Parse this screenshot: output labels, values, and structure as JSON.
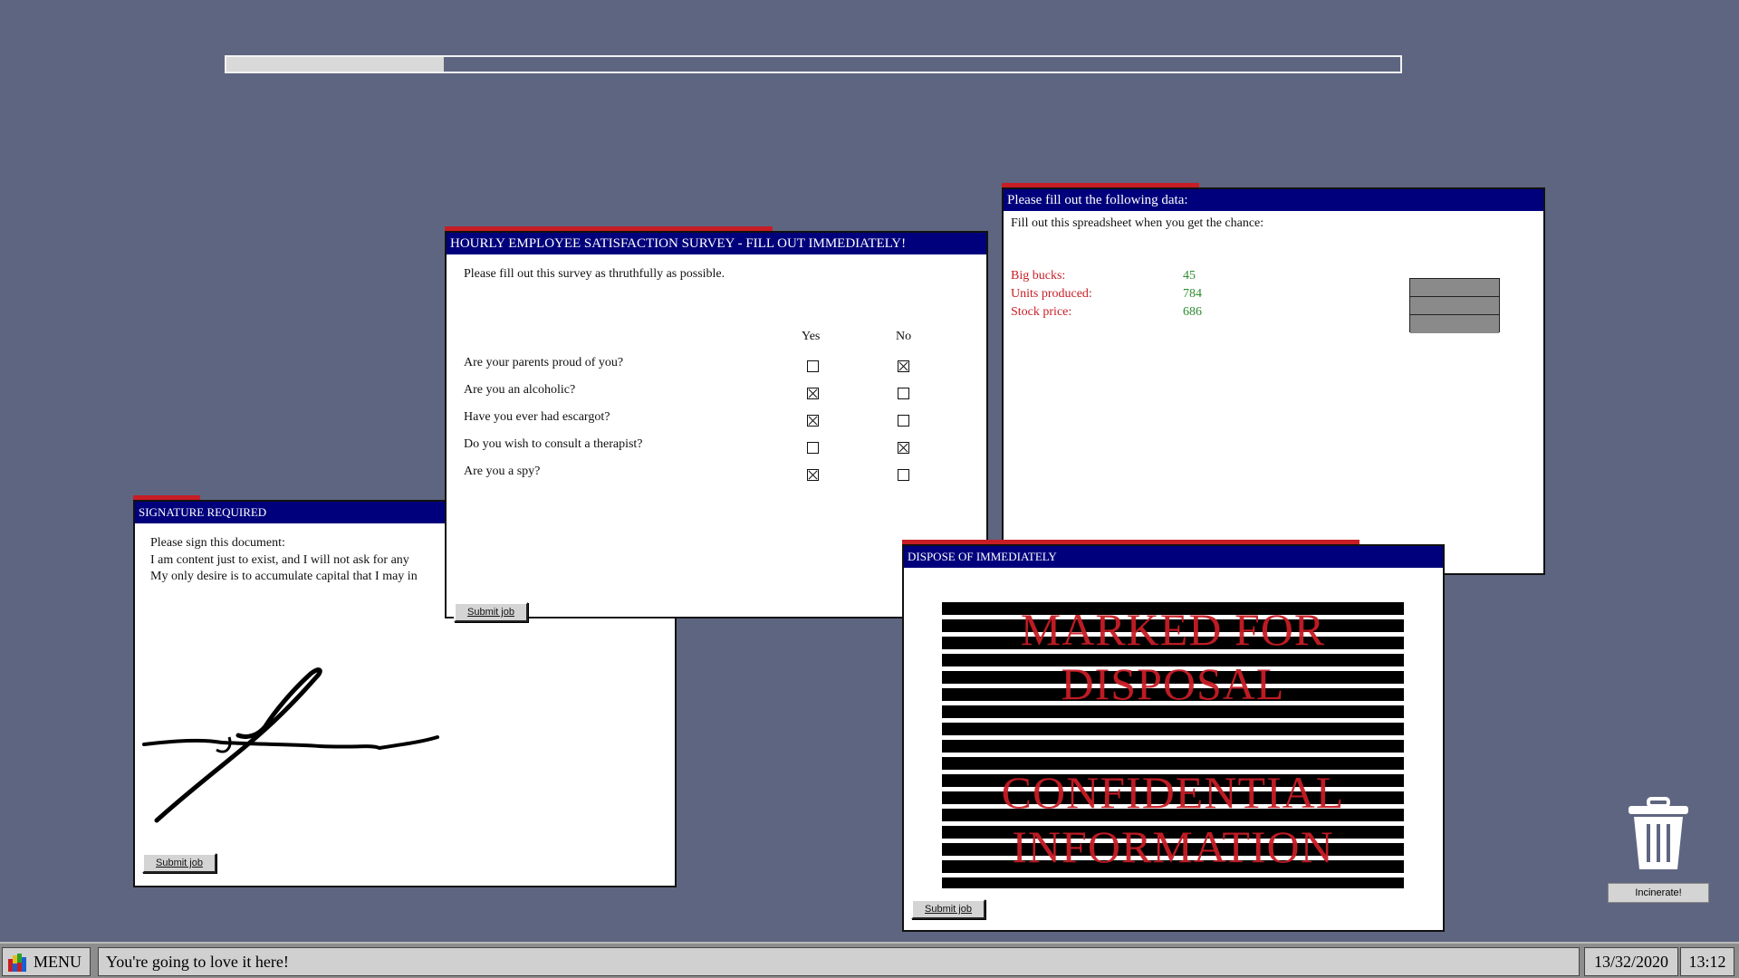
{
  "progress": {
    "value": 0.185
  },
  "signature_window": {
    "title": "SIGNATURE REQUIRED",
    "line1": "Please sign this document:",
    "line2": "I am content just to exist, and I will not ask for any",
    "line3": "My only desire is to accumulate capital that I may in",
    "submit_label": "Submit job"
  },
  "survey_window": {
    "title": "HOURLY EMPLOYEE SATISFACTION SURVEY - FILL OUT IMMEDIATELY!",
    "intro": "Please fill out this survey as thruthfully as possible.",
    "col_yes": "Yes",
    "col_no": "No",
    "questions": [
      {
        "text": "Are your parents proud of you?",
        "yes": false,
        "no": true
      },
      {
        "text": "Are you an alcoholic?",
        "yes": true,
        "no": false
      },
      {
        "text": "Have you ever had escargot?",
        "yes": true,
        "no": false
      },
      {
        "text": "Do you wish to consult a therapist?",
        "yes": false,
        "no": true
      },
      {
        "text": "Are you a spy?",
        "yes": true,
        "no": false
      }
    ],
    "submit_label": "Submit job"
  },
  "data_window": {
    "title": "Please fill out the following data:",
    "subtitle": "Fill out this spreadsheet when you get the chance:",
    "rows": [
      {
        "label": "Big bucks:",
        "value": "45"
      },
      {
        "label": "Units produced:",
        "value": "784"
      },
      {
        "label": "Stock price:",
        "value": "686"
      }
    ]
  },
  "dispose_window": {
    "title": "DISPOSE OF IMMEDIATELY",
    "stamp_line1": "MARKED FOR",
    "stamp_line2": "DISPOSAL",
    "stamp_line3": "CONFIDENTIAL",
    "stamp_line4": "INFORMATION",
    "submit_label": "Submit job"
  },
  "trash": {
    "button_label": "Incinerate!"
  },
  "taskbar": {
    "menu_label": "MENU",
    "status": "You're going to love it here!",
    "date": "13/32/2020",
    "time": "13:12"
  },
  "colors": {
    "desktop": "#5e6580",
    "title_bar": "#00007c",
    "accent_red": "#c81d25",
    "label_red": "#c81d25",
    "value_green": "#2e8b2e"
  }
}
